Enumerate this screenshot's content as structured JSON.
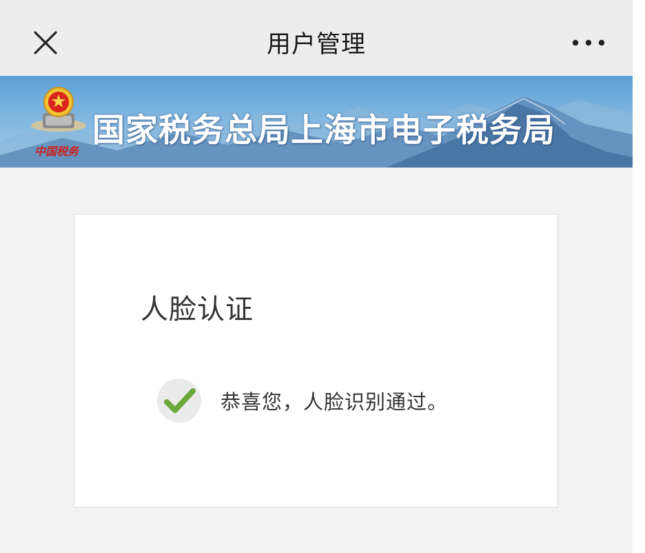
{
  "nav": {
    "title": "用户管理",
    "close_icon": "close-icon",
    "more_icon": "more-horizontal-icon"
  },
  "banner": {
    "title": "国家税务总局上海市电子税务局",
    "emblem_caption": "中国税务",
    "emblem_icon": "tax-emblem-icon"
  },
  "card": {
    "title": "人脸认证",
    "message": "恭喜您，人脸识别通过。",
    "status_icon": "check-icon"
  },
  "colors": {
    "check_green": "#6aa83a",
    "banner_blue": "#5fa0d6"
  }
}
